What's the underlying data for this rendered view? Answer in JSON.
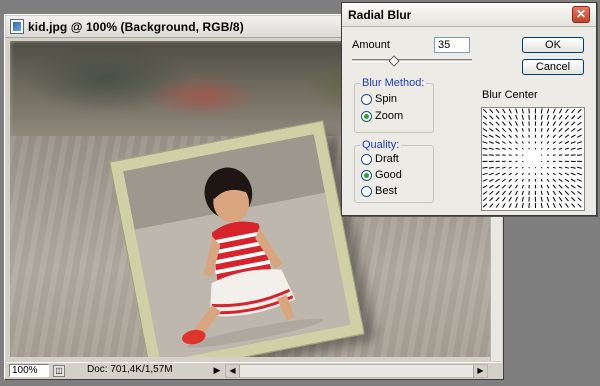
{
  "document": {
    "title": "kid.jpg @ 100% (Background, RGB/8)",
    "zoom": "100%",
    "doc_info": "Doc: 701,4K/1,57M"
  },
  "dialog": {
    "title": "Radial Blur",
    "amount_label": "Amount",
    "amount_value": "35",
    "amount_min": 1,
    "amount_max": 100,
    "ok_label": "OK",
    "cancel_label": "Cancel",
    "blur_method": {
      "legend": "Blur Method:",
      "options": [
        "Spin",
        "Zoom"
      ],
      "selected": "Zoom"
    },
    "quality": {
      "legend": "Quality:",
      "options": [
        "Draft",
        "Good",
        "Best"
      ],
      "selected": "Good"
    },
    "blur_center_label": "Blur Center"
  },
  "icons": {
    "document_icon": "photoshop-document-icon",
    "close": "close-icon",
    "scroll_left": "arrow-left-icon",
    "scroll_right": "arrow-right-icon",
    "scroll_down": "arrow-down-icon",
    "status_menu": "triangle-right-icon"
  },
  "colors": {
    "group_legend": "#1d3ec4",
    "radio_checked": "#2aa32a",
    "close_button": "#c24229",
    "frame": "#cfd0a6"
  }
}
